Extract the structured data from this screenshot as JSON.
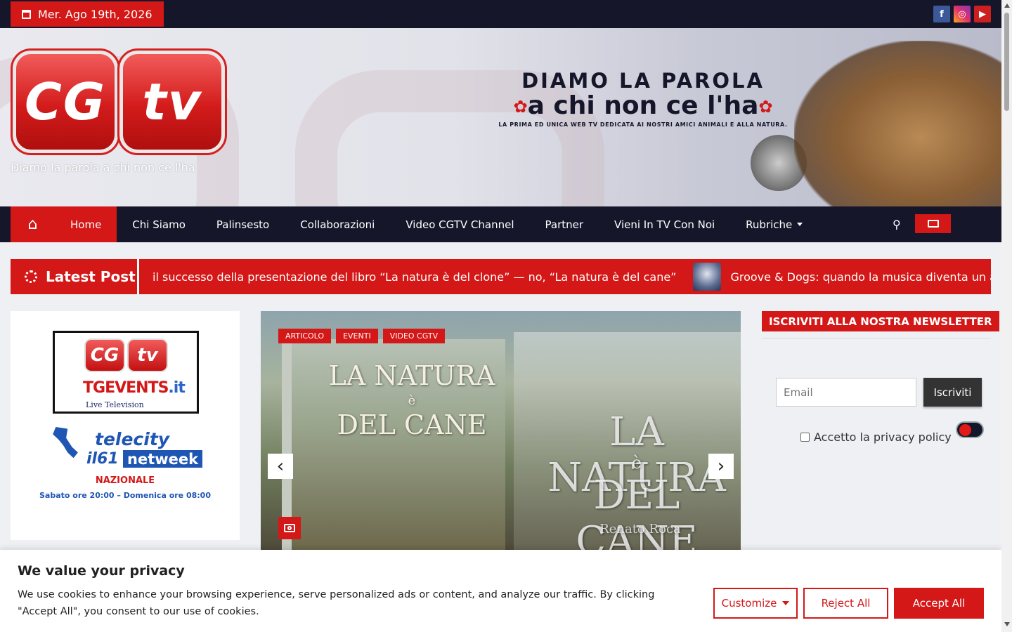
{
  "topbar": {
    "date": "Mer. Ago 19th, 2026",
    "social": [
      "facebook-icon",
      "instagram-icon",
      "youtube-icon"
    ]
  },
  "header": {
    "logo_left": "CG",
    "logo_right": "tv",
    "tagline": "Diamo la parola a chi non ce l'ha",
    "banner_line1": "DIAMO LA PAROLA",
    "banner_line2": "a chi non ce l'ha",
    "banner_line3": "LA PRIMA ED UNICA WEB TV DEDICATA AI NOSTRI AMICI ANIMALI E ALLA NATURA."
  },
  "nav": {
    "items": [
      "Home",
      "Chi Siamo",
      "Palinsesto",
      "Collaborazioni",
      "Video CGTV Channel",
      "Partner",
      "Vieni In TV Con Noi",
      "Rubriche"
    ],
    "active": "Home"
  },
  "latest": {
    "label": "Latest Post",
    "items": [
      "il successo della presentazione del libro “La natura è del clone” — no, “La natura è del cane”",
      "Groove & Dogs: quando la musica diventa un ab"
    ]
  },
  "ad": {
    "tge": "TGEVENTS",
    "tge_suffix": ".it",
    "live": "Live Television",
    "telecity": "telecity",
    "il61": "il61",
    "netweek": "netweek",
    "nazionale": "NAZIONALE",
    "orari": "Sabato ore 20:00 – Domenica ore 08:00"
  },
  "slider": {
    "categories": [
      "ARTICOLO",
      "EVENTI",
      "VIDEO CGTV"
    ],
    "book_title_1": "LA NATURA",
    "book_title_2": "è",
    "book_title_3": "DEL CANE",
    "book_author": "Renato Roca"
  },
  "newsletter": {
    "title": "ISCRIVITI ALLA NOSTRA NEWSLETTER",
    "email_placeholder": "Email",
    "button": "Iscriviti",
    "privacy": "Accetto la privacy policy"
  },
  "cookie": {
    "title": "We value your privacy",
    "text": "We use cookies to enhance your browsing experience, serve personalized ads or content, and analyze our traffic. By clicking \"Accept All\", you consent to our use of cookies.",
    "customize": "Customize",
    "reject": "Reject All",
    "accept": "Accept All"
  },
  "colors": {
    "accent": "#d41717",
    "dark": "#16162b"
  }
}
